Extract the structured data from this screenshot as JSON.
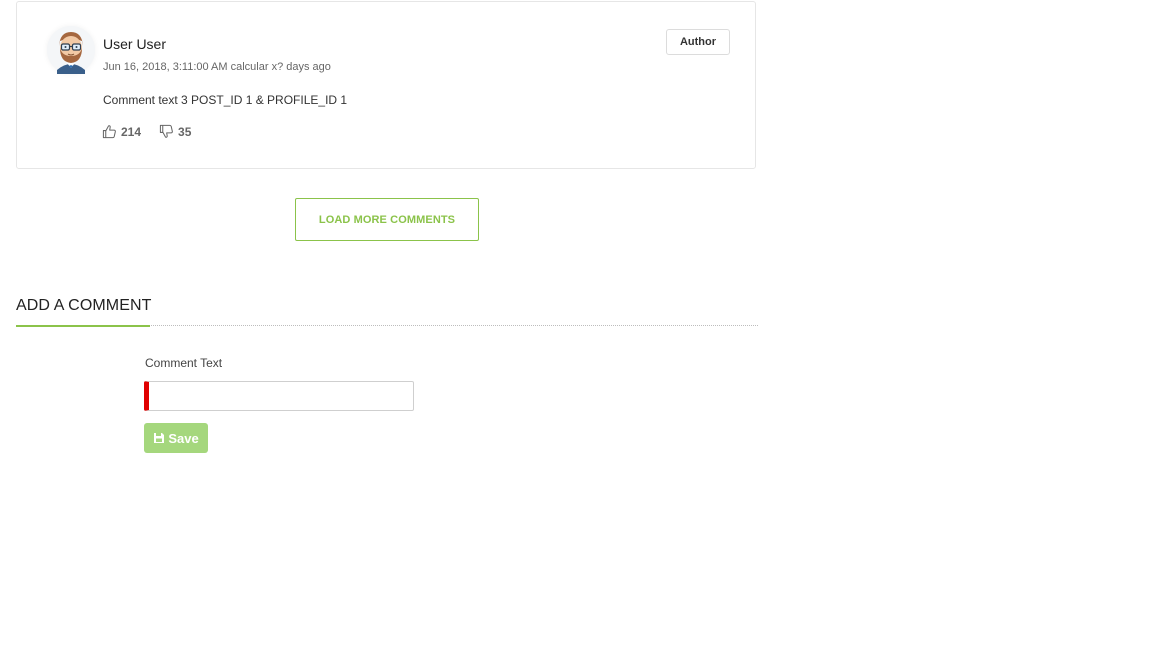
{
  "comment": {
    "user_name": "User User",
    "meta": "Jun 16, 2018, 3:11:00 AM calcular x? days ago",
    "badge": "Author",
    "text": "Comment text 3 POST_ID 1 & PROFILE_ID 1",
    "likes": "214",
    "dislikes": "35",
    "avatar_icon": "bearded-man-glasses-avatar",
    "like_icon": "thumbs-up-icon",
    "dislike_icon": "thumbs-down-icon"
  },
  "load_more": {
    "label": "LOAD MORE COMMENTS"
  },
  "add_comment": {
    "title": "ADD A COMMENT",
    "field_label": "Comment Text",
    "input_value": "",
    "save_label": "Save",
    "save_icon": "floppy-disk-icon"
  },
  "colors": {
    "accent": "#8bc34a",
    "save_button": "#a5d77d",
    "required_marker": "#e00000"
  }
}
